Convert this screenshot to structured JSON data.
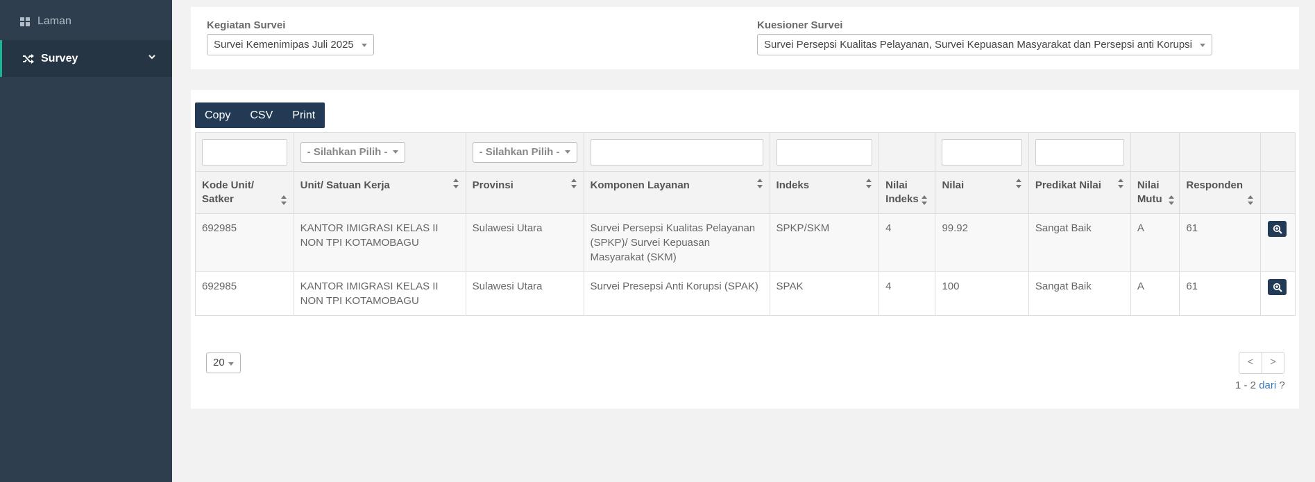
{
  "sidebar": {
    "items": [
      {
        "label": "Laman",
        "icon": "dashboard-icon"
      },
      {
        "label": "Survey",
        "icon": "shuffle-icon",
        "active": true
      }
    ]
  },
  "filters": {
    "kegiatan_label": "Kegiatan Survei",
    "kegiatan_value": "Survei Kemenimipas Juli 2025",
    "kuesioner_label": "Kuesioner Survei",
    "kuesioner_value": "Survei Persepsi Kualitas Pelayanan, Survei Kepuasan Masyarakat dan Persepsi anti Korupsi"
  },
  "toolbar": {
    "copy": "Copy",
    "csv": "CSV",
    "print": "Print"
  },
  "table": {
    "filter_select_placeholder": "- Silahkan Pilih -",
    "headers": [
      "Kode Unit/ Satker",
      "Unit/ Satuan Kerja",
      "Provinsi",
      "Komponen Layanan",
      "Indeks",
      "Nilai Indeks",
      "Nilai",
      "Predikat Nilai",
      "Nilai Mutu",
      "Responden"
    ],
    "rows": [
      [
        "692985",
        "KANTOR IMIGRASI KELAS II NON TPI KOTAMOBAGU",
        "Sulawesi Utara",
        "Survei Persepsi Kualitas Pelayanan (SPKP)/ Survei Kepuasan Masyarakat (SKM)",
        "SPKP/SKM",
        "4",
        "99.92",
        "Sangat Baik",
        "A",
        "61"
      ],
      [
        "692985",
        "KANTOR IMIGRASI KELAS II NON TPI KOTAMOBAGU",
        "Sulawesi Utara",
        "Survei Presepsi Anti Korupsi (SPAK)",
        "SPAK",
        "4",
        "100",
        "Sangat Baik",
        "A",
        "61"
      ]
    ]
  },
  "pagination": {
    "page_size": "20",
    "prev": "<",
    "next": ">",
    "range": "1 - 2",
    "of_label": "dari",
    "total": "?"
  },
  "colors": {
    "sidebar_bg": "#2e3e4e",
    "accent": "#1ab394",
    "button_bg": "#233a55"
  }
}
